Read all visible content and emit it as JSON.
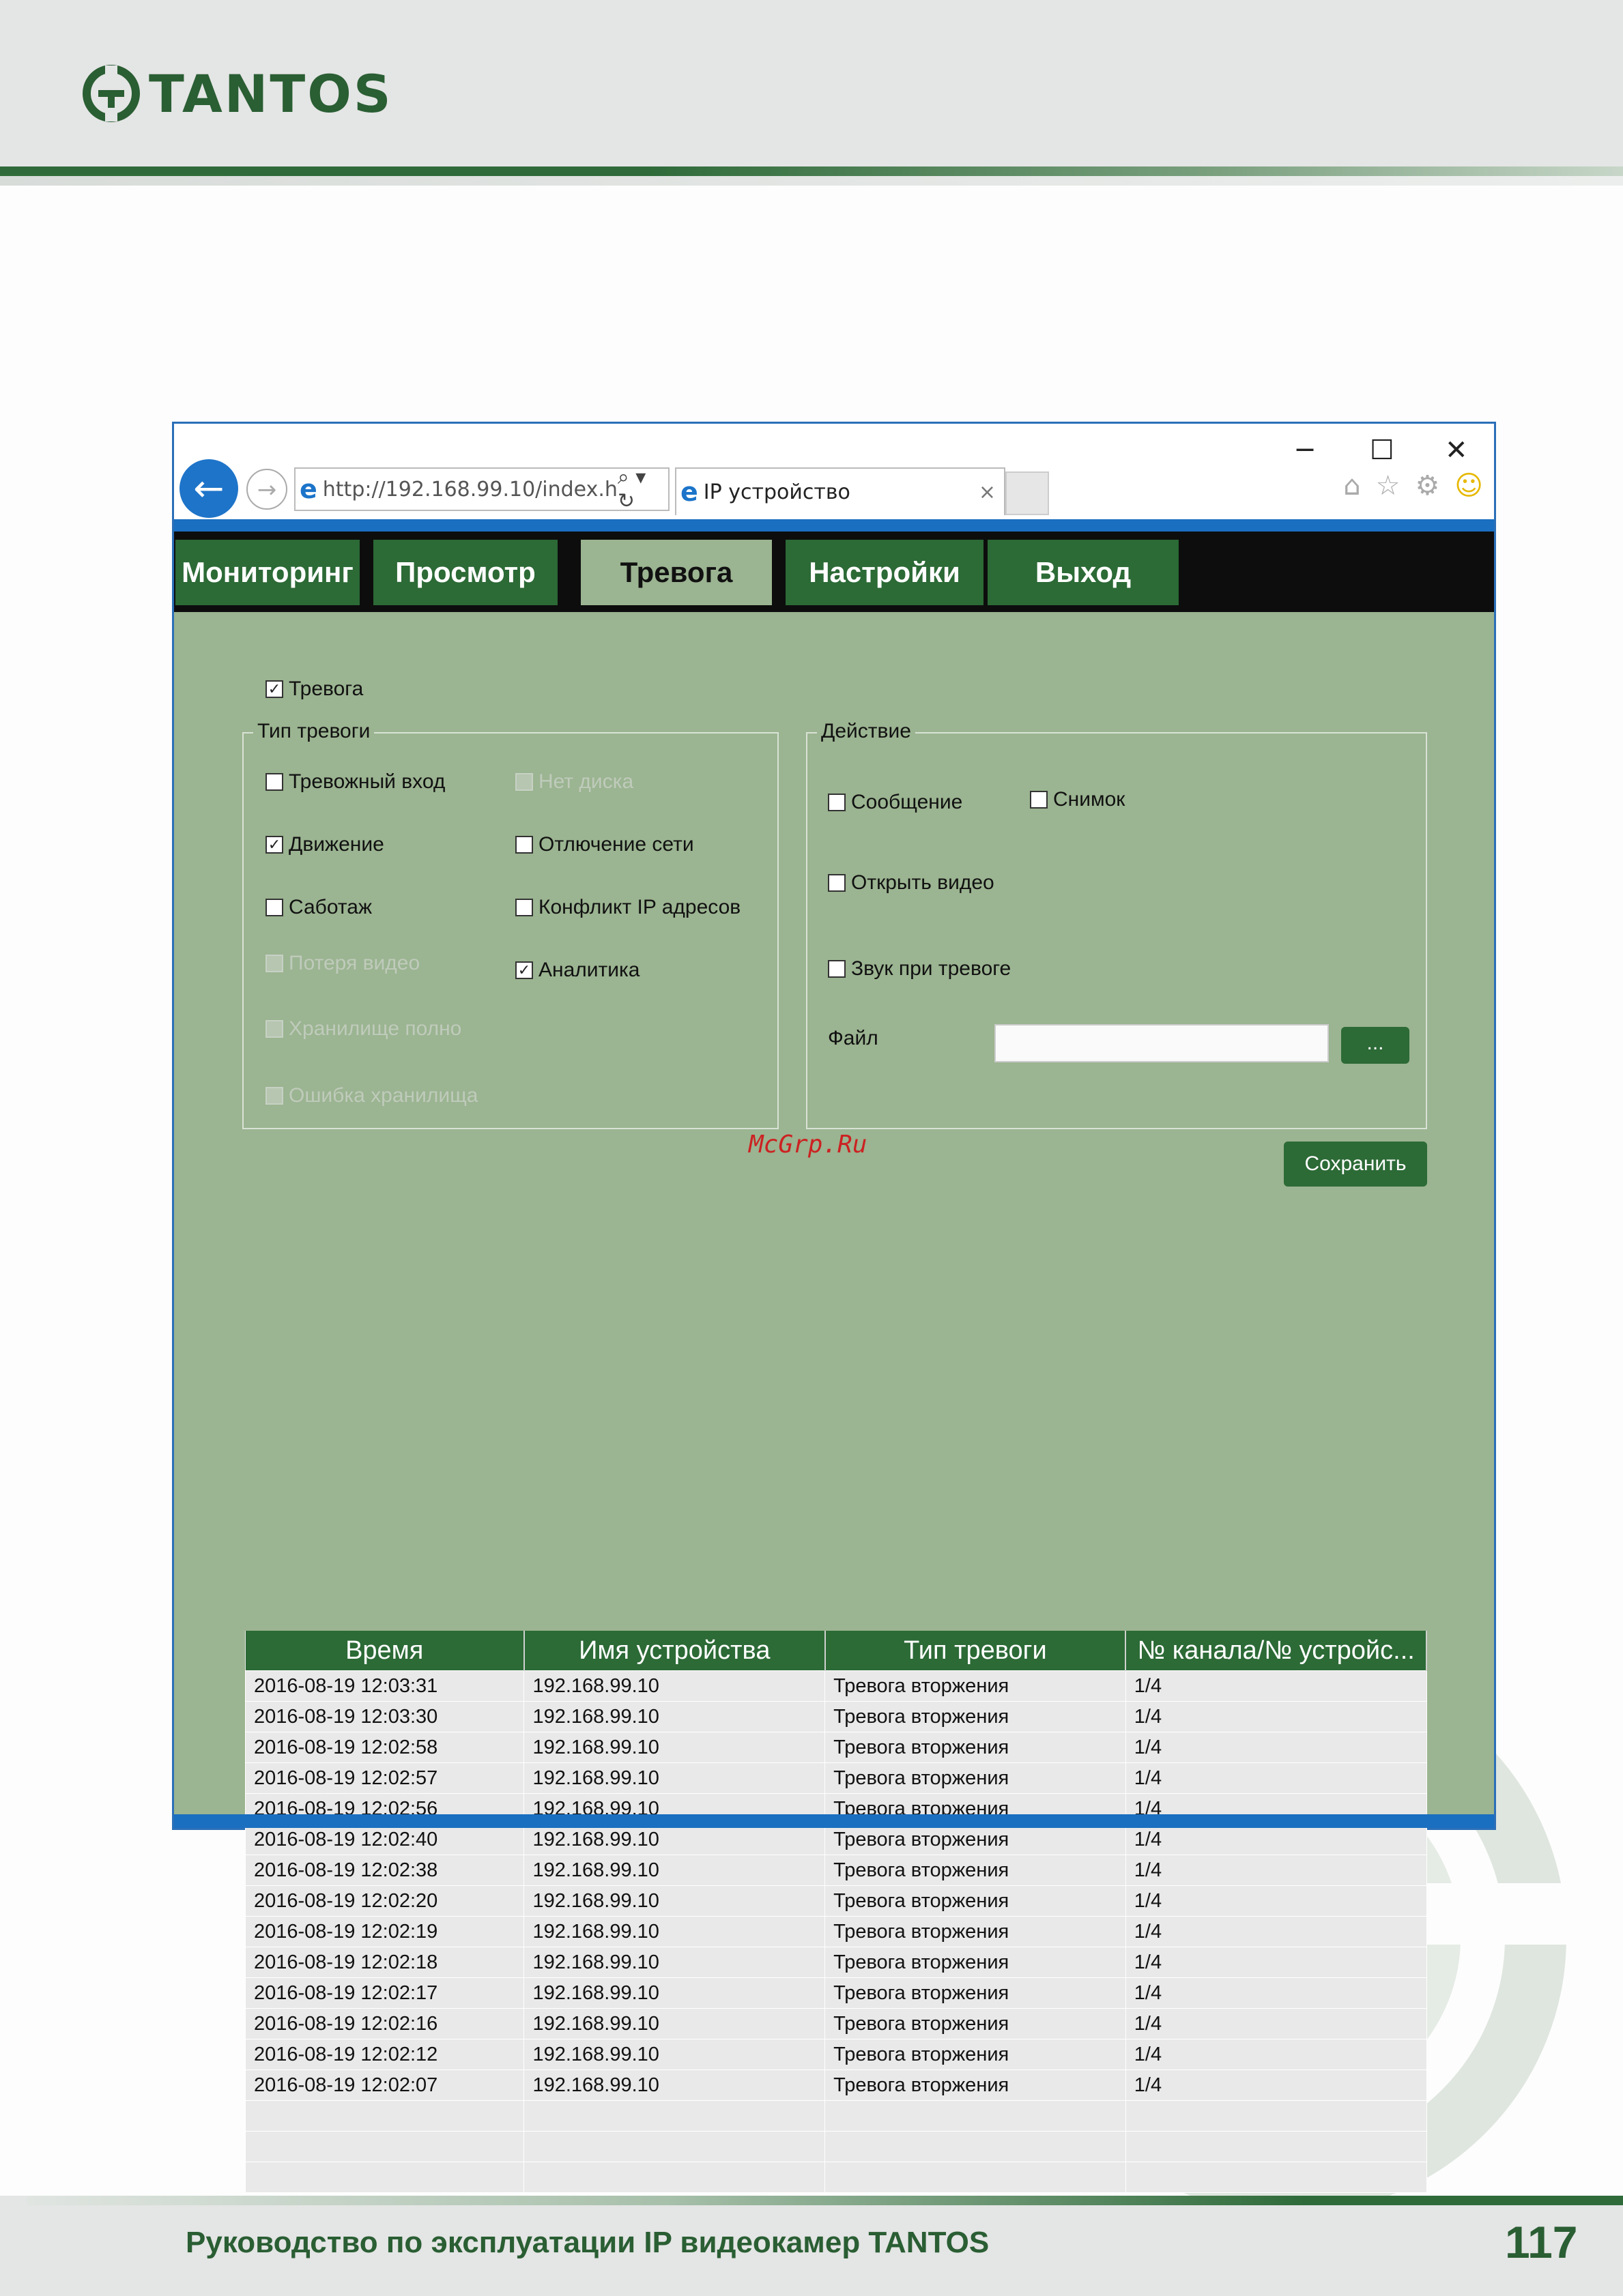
{
  "brand": {
    "name": "TANTOS"
  },
  "browser": {
    "address": "http://192.168.99.10/index.h",
    "tab_title": "IP устройство",
    "minimize": "─",
    "maximize": "☐",
    "close": "✕"
  },
  "nav": {
    "tabs": [
      {
        "label": "Мониторинг"
      },
      {
        "label": "Просмотр"
      },
      {
        "label": "Тревога"
      },
      {
        "label": "Настройки"
      },
      {
        "label": "Выход"
      }
    ],
    "active": "Тревога"
  },
  "alarm": {
    "enable_label": "Тревога",
    "enable_checked": true,
    "type_group": {
      "legend": "Тип тревоги",
      "items": [
        {
          "label": "Тревожный вход",
          "checked": false,
          "disabled": false
        },
        {
          "label": "Нет диска",
          "checked": false,
          "disabled": true
        },
        {
          "label": "Движение",
          "checked": true,
          "disabled": false
        },
        {
          "label": "Отлючение сети",
          "checked": false,
          "disabled": false
        },
        {
          "label": "Саботаж",
          "checked": false,
          "disabled": false
        },
        {
          "label": "Конфликт IP адресов",
          "checked": false,
          "disabled": false
        },
        {
          "label": "Потеря видео",
          "checked": false,
          "disabled": true
        },
        {
          "label": "Аналитика",
          "checked": true,
          "disabled": false
        },
        {
          "label": "Хранилище полно",
          "checked": false,
          "disabled": true
        },
        {
          "label": "Ошибка хранилища",
          "checked": false,
          "disabled": true
        }
      ]
    },
    "action_group": {
      "legend": "Действие",
      "items": [
        {
          "label": "Сообщение",
          "checked": false
        },
        {
          "label": "Снимок",
          "checked": false
        },
        {
          "label": "Открыть видео",
          "checked": false
        },
        {
          "label": "Звук при тревоге",
          "checked": false
        }
      ],
      "file_label": "Файл",
      "file_value": "",
      "browse_label": "..."
    },
    "save_label": "Сохранить"
  },
  "watermark_text": "McGrp.Ru",
  "log_table": {
    "columns": [
      "Время",
      "Имя устройства",
      "Тип тревоги",
      "№ канала/№ устройс..."
    ],
    "rows": [
      [
        "2016-08-19 12:03:31",
        "192.168.99.10",
        "Тревога вторжения",
        "1/4"
      ],
      [
        "2016-08-19 12:03:30",
        "192.168.99.10",
        "Тревога вторжения",
        "1/4"
      ],
      [
        "2016-08-19 12:02:58",
        "192.168.99.10",
        "Тревога вторжения",
        "1/4"
      ],
      [
        "2016-08-19 12:02:57",
        "192.168.99.10",
        "Тревога вторжения",
        "1/4"
      ],
      [
        "2016-08-19 12:02:56",
        "192.168.99.10",
        "Тревога вторжения",
        "1/4"
      ],
      [
        "2016-08-19 12:02:40",
        "192.168.99.10",
        "Тревога вторжения",
        "1/4"
      ],
      [
        "2016-08-19 12:02:38",
        "192.168.99.10",
        "Тревога вторжения",
        "1/4"
      ],
      [
        "2016-08-19 12:02:20",
        "192.168.99.10",
        "Тревога вторжения",
        "1/4"
      ],
      [
        "2016-08-19 12:02:19",
        "192.168.99.10",
        "Тревога вторжения",
        "1/4"
      ],
      [
        "2016-08-19 12:02:18",
        "192.168.99.10",
        "Тревога вторжения",
        "1/4"
      ],
      [
        "2016-08-19 12:02:17",
        "192.168.99.10",
        "Тревога вторжения",
        "1/4"
      ],
      [
        "2016-08-19 12:02:16",
        "192.168.99.10",
        "Тревога вторжения",
        "1/4"
      ],
      [
        "2016-08-19 12:02:12",
        "192.168.99.10",
        "Тревога вторжения",
        "1/4"
      ],
      [
        "2016-08-19 12:02:07",
        "192.168.99.10",
        "Тревога вторжения",
        "1/4"
      ]
    ],
    "empty_rows": 3
  },
  "footer": {
    "title": "Руководство по эксплуатации IP видеокамер TANTOS",
    "page": "117"
  },
  "colors": {
    "brand_green": "#2a5e33",
    "panel_green": "#9bb491",
    "browser_blue": "#1a6fc0"
  }
}
